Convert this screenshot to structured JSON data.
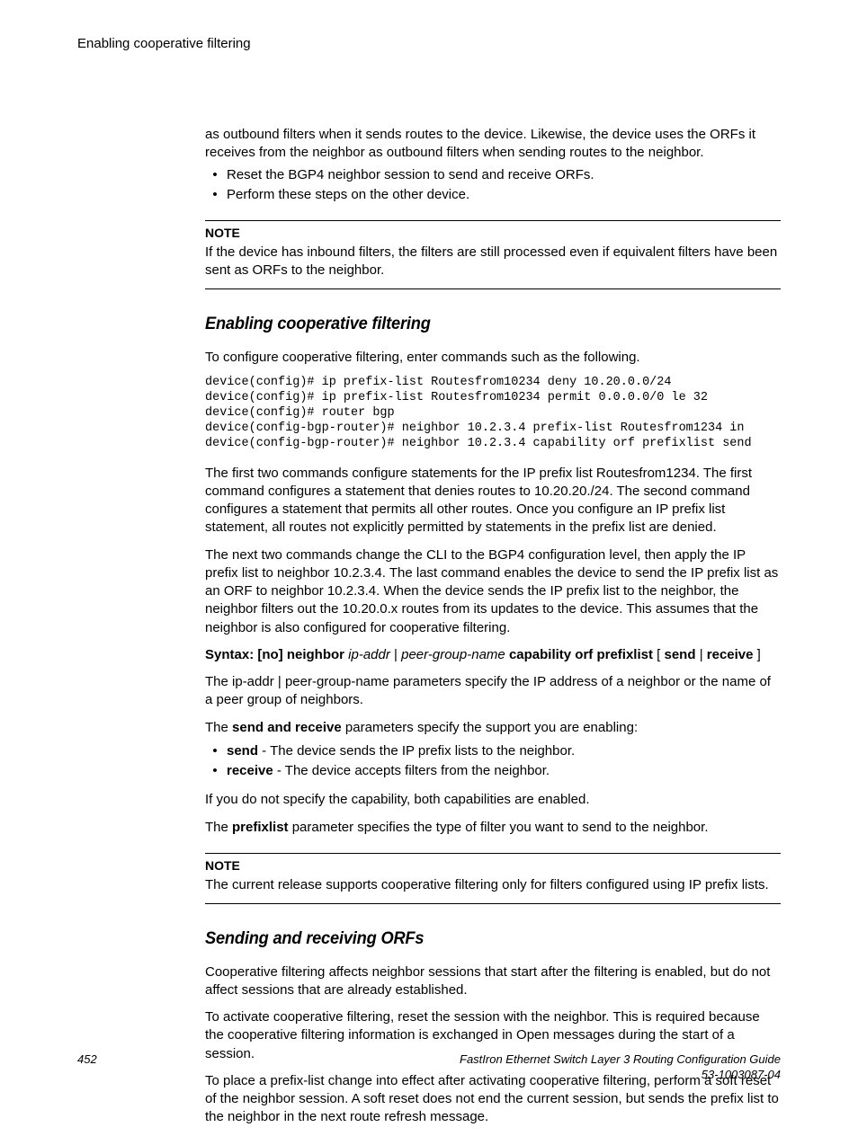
{
  "header": {
    "title": "Enabling cooperative filtering"
  },
  "intro": {
    "continued": "as outbound filters when it sends routes to the device. Likewise, the device uses the ORFs it receives from the neighbor as outbound filters when sending routes to the neighbor.",
    "bullets": [
      "Reset the BGP4 neighbor session to send and receive ORFs.",
      "Perform these steps on the other device."
    ]
  },
  "note1": {
    "label": "NOTE",
    "body": "If the device has inbound filters, the filters are still processed even if equivalent filters have been sent as ORFs to the neighbor."
  },
  "section1": {
    "heading": "Enabling cooperative filtering",
    "lead": "To configure cooperative filtering, enter commands such as the following.",
    "code": "device(config)# ip prefix-list Routesfrom10234 deny 10.20.0.0/24\ndevice(config)# ip prefix-list Routesfrom10234 permit 0.0.0.0/0 le 32\ndevice(config)# router bgp\ndevice(config-bgp-router)# neighbor 10.2.3.4 prefix-list Routesfrom1234 in\ndevice(config-bgp-router)# neighbor 10.2.3.4 capability orf prefixlist send",
    "p1": "The first two commands configure statements for the IP prefix list Routesfrom1234. The first command configures a statement that denies routes to 10.20.20./24. The second command configures a statement that permits all other routes. Once you configure an IP prefix list statement, all routes not explicitly permitted by statements in the prefix list are denied.",
    "p2": "The next two commands change the CLI to the BGP4 configuration level, then apply the IP prefix list to neighbor 10.2.3.4. The last command enables the device to send the IP prefix list as an ORF to neighbor 10.2.3.4. When the device sends the IP prefix list to the neighbor, the neighbor filters out the 10.20.0.x routes from its updates to the device. This assumes that the neighbor is also configured for cooperative filtering.",
    "syntax": {
      "s1": "Syntax: [no] neighbor",
      "s2": "ip-addr",
      "s3_pipe": " | ",
      "s4": "peer-group-name",
      "s5": " capability orf prefixlist",
      "s6_open": " [ ",
      "s7": "send",
      "s8_pipe": " | ",
      "s9": "receive",
      "s10_close": " ]"
    },
    "p3": "The ip-addr | peer-group-name parameters specify the IP address of a neighbor or the name of a peer group of neighbors.",
    "p4_pre": "The ",
    "p4_b": "send and receive",
    "p4_post": " parameters specify the support you are enabling:",
    "bullets": {
      "b1_pre": "",
      "b1_bold": "send",
      "b1_post": " - The device sends the IP prefix lists to the neighbor.",
      "b2_pre": "",
      "b2_bold": "receive",
      "b2_post": " - The device accepts filters from the neighbor."
    },
    "p5": "If you do not specify the capability, both capabilities are enabled.",
    "p6_pre": "The ",
    "p6_b": "prefixlist",
    "p6_post": " parameter specifies the type of filter you want to send to the neighbor."
  },
  "note2": {
    "label": "NOTE",
    "body": "The current release supports cooperative filtering only for filters configured using IP prefix lists."
  },
  "section2": {
    "heading": "Sending and receiving ORFs",
    "p1": "Cooperative filtering affects neighbor sessions that start after the filtering is enabled, but do not affect sessions that are already established.",
    "p2": "To activate cooperative filtering, reset the session with the neighbor. This is required because the cooperative filtering information is exchanged in Open messages during the start of a session.",
    "p3": "To place a prefix-list change into effect after activating cooperative filtering, perform a soft reset of the neighbor session. A soft reset does not end the current session, but sends the prefix list to the neighbor in the next route refresh message."
  },
  "footer": {
    "page": "452",
    "guide": "FastIron Ethernet Switch Layer 3 Routing Configuration Guide",
    "docnum": "53-1003087-04"
  }
}
